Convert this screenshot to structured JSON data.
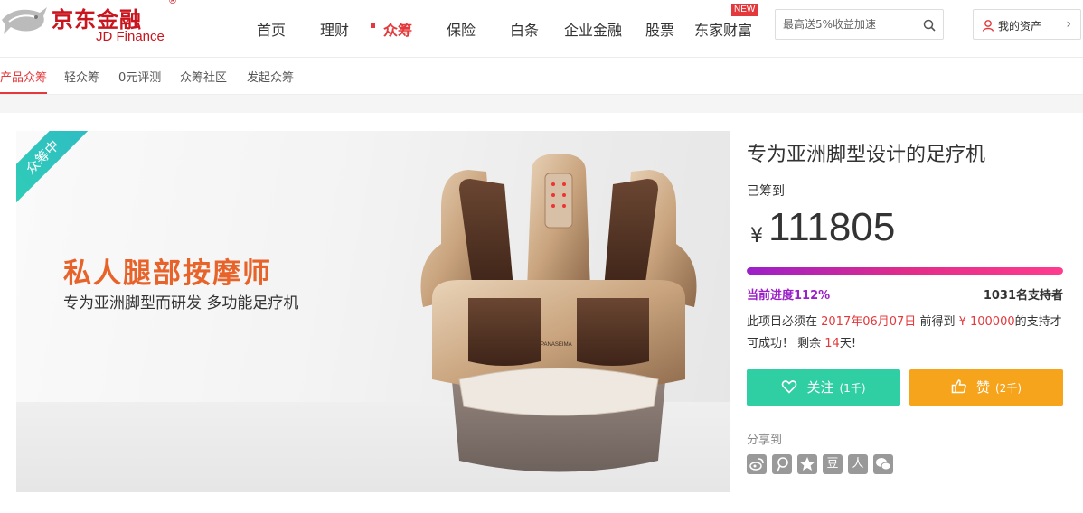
{
  "brand": {
    "cn": "京东金融",
    "en": "JD Finance",
    "reg": "®"
  },
  "nav": [
    {
      "label": "首页",
      "active": false
    },
    {
      "label": "理财",
      "active": false
    },
    {
      "label": "众筹",
      "active": true
    },
    {
      "label": "保险",
      "active": false
    },
    {
      "label": "白条",
      "active": false
    },
    {
      "label": "企业金融",
      "active": false
    },
    {
      "label": "股票",
      "active": false
    },
    {
      "label": "东家财富",
      "active": false
    }
  ],
  "new_badge": "NEW",
  "search": {
    "placeholder": "最高送5%收益加速"
  },
  "asset": {
    "label": "我的资产"
  },
  "subnav": [
    {
      "label": "产品众筹",
      "active": true
    },
    {
      "label": "轻众筹",
      "active": false
    },
    {
      "label": "0元评测",
      "active": false
    },
    {
      "label": "众筹社区",
      "active": false
    },
    {
      "label": "发起众筹",
      "active": false
    }
  ],
  "banner": {
    "status": "众筹中",
    "title": "私人腿部按摩师",
    "subtitle": "专为亚洲脚型而研发 多功能足疗机",
    "product_brand": "PANASEIMA"
  },
  "project": {
    "title": "专为亚洲脚型设计的足疗机",
    "raised_label": "已筹到",
    "currency": "¥",
    "raised_amount": "111805",
    "progress_label": "当前进度112%",
    "progress_percent": 112,
    "supporters": "1031名支持者",
    "desc": {
      "p1": "此项目必须在 ",
      "deadline": "2017年06月07日",
      "p2": " 前得到 ",
      "target": "¥ 100000",
      "p3": "的支持才可成功！ 剩余 ",
      "days": "14",
      "p4": "天!"
    }
  },
  "actions": {
    "follow": {
      "label": "关注",
      "count": "(1千)"
    },
    "like": {
      "label": "赞",
      "count": "(2千)"
    }
  },
  "share": {
    "label": "分享到",
    "icons": [
      "weibo-icon",
      "tencent-weibo-icon",
      "qzone-icon",
      "douban-icon",
      "renren-icon",
      "wechat-icon"
    ],
    "glyphs": [
      "",
      "",
      "",
      "豆",
      "人",
      ""
    ]
  },
  "colors": {
    "accent": "#e4393c",
    "follow": "#2fcfa3",
    "like": "#f7a41d",
    "progress": "#9b1fc9"
  }
}
